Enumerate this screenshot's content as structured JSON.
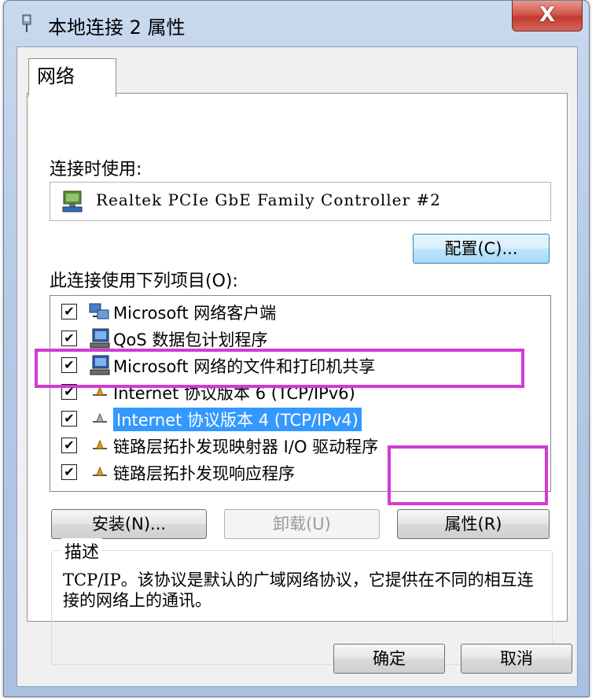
{
  "window": {
    "title": "本地连接 2 属性",
    "close_label": "X"
  },
  "tabs": [
    {
      "label": "网络"
    }
  ],
  "connect_using": {
    "label": "连接时使用:",
    "adapter": "Realtek PCIe GbE Family Controller #2",
    "configure_button": "配置(C)..."
  },
  "items_label": "此连接使用下列项目(O):",
  "items": [
    {
      "label": "Microsoft 网络客户端",
      "checked": "✔",
      "icon": "network-client-icon"
    },
    {
      "label": "QoS 数据包计划程序",
      "checked": "✔",
      "icon": "computer-icon"
    },
    {
      "label": "Microsoft 网络的文件和打印机共享",
      "checked": "✔",
      "icon": "computer-icon"
    },
    {
      "label": "Internet 协议版本 6 (TCP/IPv6)",
      "checked": "✔",
      "icon": "protocol-icon"
    },
    {
      "label": "Internet 协议版本 4 (TCP/IPv4)",
      "checked": "✔",
      "icon": "protocol-icon",
      "selected": true
    },
    {
      "label": "链路层拓扑发现映射器 I/O 驱动程序",
      "checked": "✔",
      "icon": "protocol-icon"
    },
    {
      "label": "链路层拓扑发现响应程序",
      "checked": "✔",
      "icon": "protocol-icon"
    }
  ],
  "buttons": {
    "install": "安装(N)...",
    "uninstall": "卸载(U)",
    "properties": "属性(R)",
    "ok": "确定",
    "cancel": "取消"
  },
  "description": {
    "title": "描述",
    "text": "TCP/IP。该协议是默认的广域网络协议，它提供在不同的相互连接的网络上的通讯。"
  },
  "colors": {
    "highlight": "#d23bd2",
    "selection": "#3399ff"
  }
}
